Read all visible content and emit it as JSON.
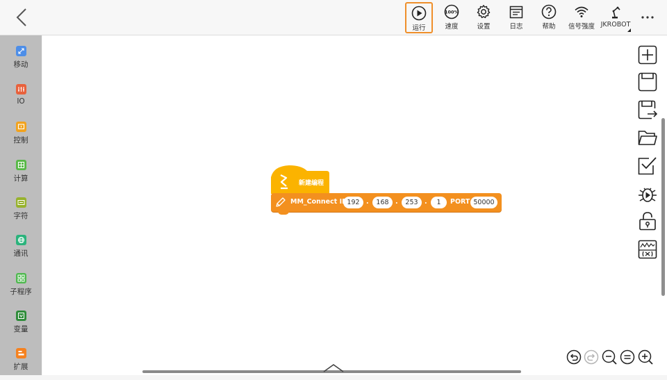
{
  "toolbar": {
    "run": "运行",
    "speed": "速度",
    "speed_badge": "100%",
    "settings": "设置",
    "log": "日志",
    "help": "帮助",
    "signal": "信号强度",
    "robot": "JKROBOT"
  },
  "sidebar": {
    "items": [
      {
        "label": "移动",
        "color": "#4d8ee8"
      },
      {
        "label": "IO",
        "color": "#e8613c"
      },
      {
        "label": "控制",
        "color": "#f2a31e"
      },
      {
        "label": "计算",
        "color": "#58b947"
      },
      {
        "label": "字符",
        "color": "#97b22d"
      },
      {
        "label": "通讯",
        "color": "#2bb37c"
      },
      {
        "label": "子程序",
        "color": "#4fb84f"
      },
      {
        "label": "变量",
        "color": "#2f8c3a"
      },
      {
        "label": "扩展",
        "color": "#f58220"
      }
    ]
  },
  "program": {
    "hat_label": "新建编程",
    "hat_color": "#fbb300",
    "block_color": "#f3901f",
    "command": "MM_Connect IP",
    "ip": [
      "192",
      "168",
      "253",
      "1"
    ],
    "dot": ".",
    "port_label": "PORT",
    "port": "50000"
  },
  "colors": {
    "accent": "#ef8f2a"
  }
}
